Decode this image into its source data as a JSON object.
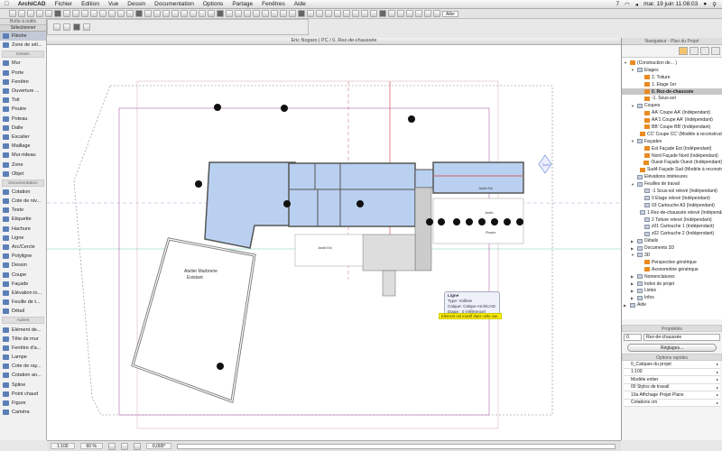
{
  "menubar": {
    "app": "ArchiCAD",
    "items": [
      "Fichier",
      "Edition",
      "Vue",
      "Dessin",
      "Documentation",
      "Options",
      "Partage",
      "Fenêtres",
      "Aide"
    ],
    "clock": "mar. 19 juin  11:08:03",
    "extra": "7"
  },
  "toolbar": {
    "aller": "Aller"
  },
  "toolbox": {
    "title": "Boîte à outils",
    "select": "Sélectionner",
    "top": [
      "Flèche",
      "Zone de sél..."
    ],
    "dessin_label": "Dessin",
    "dessin": [
      "Mur",
      "Porte",
      "Fenêtre",
      "Ouverture ...",
      "Toit",
      "Poutre",
      "Poteau",
      "Dalle",
      "Escalier",
      "Maillage",
      "Mur-rideau",
      "Zone",
      "Objet"
    ],
    "doc_label": "Documentation",
    "doc": [
      "Cotation",
      "Cote de niv...",
      "Texte",
      "Etiquette",
      "Hachure",
      "Ligne",
      "Arc/Cercle",
      "Polyligne",
      "Dessin",
      "Coupe",
      "Façade",
      "Elévation in...",
      "Feuille de t...",
      "Détail"
    ],
    "autres_label": "Autres",
    "autres": [
      "Elément de...",
      "Tête de mur",
      "Fenêtre d'a...",
      "Lampe",
      "Cote de ray...",
      "Cotation an...",
      "Spline",
      "Point chaud",
      "Figure",
      "Caméra"
    ]
  },
  "document": {
    "title": "Eric Nogaro | PC / 0. Rez-de-chaussée"
  },
  "plan": {
    "labels": [
      "Atelier Marbrerie",
      "Existant",
      "Jardin Est",
      "Jardin Est",
      "Jardin",
      "Piscine",
      "Sud4"
    ]
  },
  "tooltip": {
    "title": "Ligne",
    "type": "Type: Vollinie",
    "calque": "Calque: Calque ArchiCAD",
    "etage": "Etage : 0 (référence)",
    "warning": "Elément est inactif dans cette vue."
  },
  "status": {
    "scale": "1:100",
    "zoom": "60 %",
    "angle": "0,000°"
  },
  "navigator": {
    "title": "Navigateur - Plan du Projet",
    "items": [
      {
        "l": "(Construction de... )",
        "d": 0,
        "t": "f",
        "open": true
      },
      {
        "l": "Etages",
        "d": 1,
        "t": "g",
        "open": true
      },
      {
        "l": "2. Toiture",
        "d": 2,
        "t": "f"
      },
      {
        "l": "1. Etage 1er",
        "d": 2,
        "t": "f"
      },
      {
        "l": "0. Rez-de-chaussée",
        "d": 2,
        "t": "f",
        "sel": true
      },
      {
        "l": "-1. Sous-sol",
        "d": 2,
        "t": "f"
      },
      {
        "l": "Coupes",
        "d": 1,
        "t": "g",
        "open": true
      },
      {
        "l": "AA' Coupe AA' (Indépendant)",
        "d": 2,
        "t": "f"
      },
      {
        "l": "AA'1 Coupe AA' (Indépendant)",
        "d": 2,
        "t": "f"
      },
      {
        "l": "BB' Coupe BB' (Indépendant)",
        "d": 2,
        "t": "f"
      },
      {
        "l": "CC' Coupe CC' (Modèle à reconstruction)",
        "d": 2,
        "t": "f"
      },
      {
        "l": "Façades",
        "d": 1,
        "t": "g",
        "open": true
      },
      {
        "l": "Est Façade Est (Indépendant)",
        "d": 2,
        "t": "f"
      },
      {
        "l": "Nord Façade Nord (Indépendant)",
        "d": 2,
        "t": "f"
      },
      {
        "l": "Ouest Façade Ouest (Indépendant)",
        "d": 2,
        "t": "f"
      },
      {
        "l": "Sud4 Façade Sud (Modèle à reconstruction)",
        "d": 2,
        "t": "f"
      },
      {
        "l": "Elévations intérieures",
        "d": 1,
        "t": "g"
      },
      {
        "l": "Feuilles de travail",
        "d": 1,
        "t": "g",
        "open": true
      },
      {
        "l": "-1 Sous-sol relevé (Indépendant)",
        "d": 2,
        "t": "g"
      },
      {
        "l": "0 Etage relevé (Indépendant)",
        "d": 2,
        "t": "g"
      },
      {
        "l": "03 Cartouche A3 (Indépendant)",
        "d": 2,
        "t": "g"
      },
      {
        "l": "1 Rez-de-chaussée relevé (Indépendant)",
        "d": 2,
        "t": "g"
      },
      {
        "l": "2 Toiture relevé (Indépendant)",
        "d": 2,
        "t": "g"
      },
      {
        "l": "z01 Cartouche 1 (Indépendant)",
        "d": 2,
        "t": "g"
      },
      {
        "l": "z02 Cartouche 2 (Indépendant)",
        "d": 2,
        "t": "g"
      },
      {
        "l": "Détails",
        "d": 1,
        "t": "g",
        "closed": true
      },
      {
        "l": "Documents 3D",
        "d": 1,
        "t": "g",
        "closed": true
      },
      {
        "l": "3D",
        "d": 1,
        "t": "g",
        "open": true
      },
      {
        "l": "Perspective générique",
        "d": 2,
        "t": "f"
      },
      {
        "l": "Axonométrie générique",
        "d": 2,
        "t": "f"
      },
      {
        "l": "Nomenclatures",
        "d": 1,
        "t": "g",
        "closed": true
      },
      {
        "l": "Index de projet",
        "d": 1,
        "t": "g",
        "closed": true
      },
      {
        "l": "Listes",
        "d": 1,
        "t": "g",
        "closed": true
      },
      {
        "l": "Infos",
        "d": 1,
        "t": "g",
        "closed": true
      },
      {
        "l": "Aide",
        "d": 0,
        "t": "g",
        "closed": true
      }
    ]
  },
  "properties": {
    "title": "Propriétés",
    "id": "0.",
    "name": "Rez-de-chaussée",
    "settings": "Réglages..."
  },
  "quick_options": {
    "title": "Options rapides",
    "items": [
      "0_Calques du projet",
      "1:100",
      "Modèle entier",
      "00 Stylos de travail",
      "10a Affichage Projet Plans",
      "Cotations cm"
    ]
  }
}
